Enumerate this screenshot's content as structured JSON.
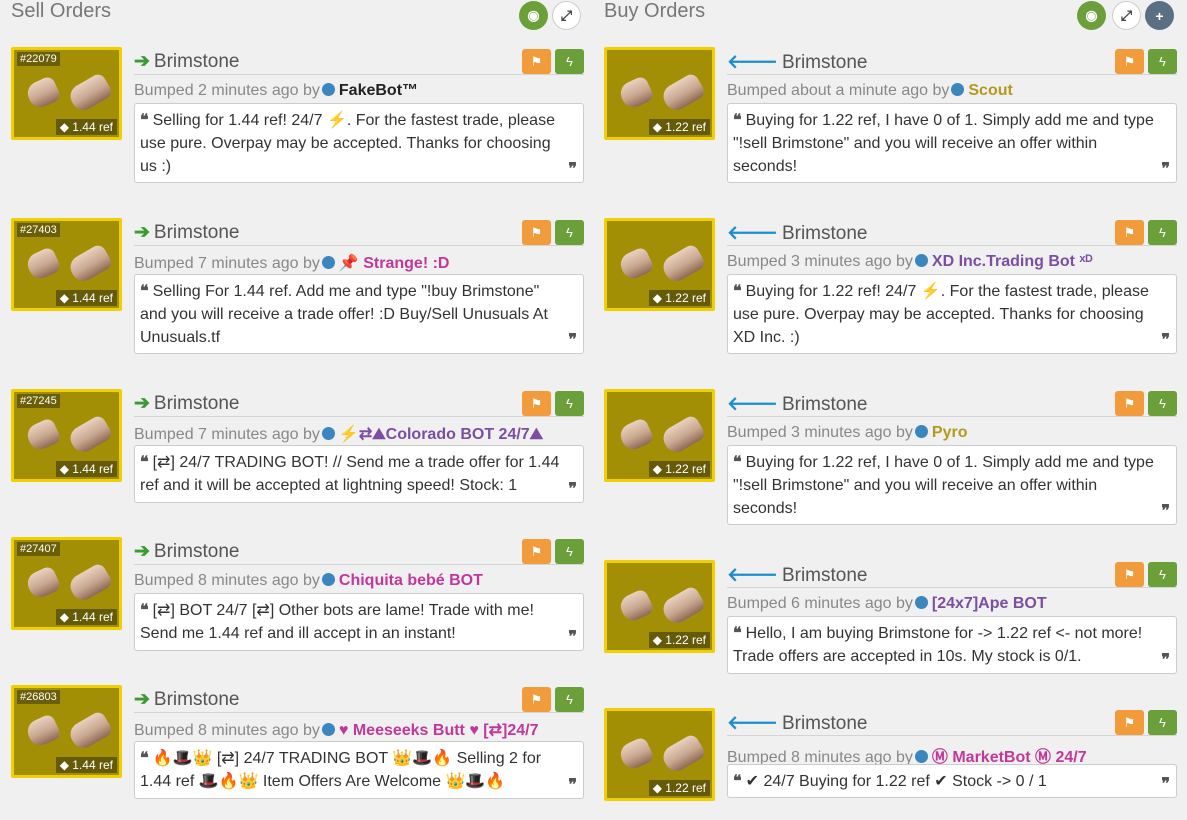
{
  "sell": {
    "title": "Sell Orders",
    "buttons": {
      "visibility": "◉",
      "expand": "⤢"
    },
    "listings": [
      {
        "id": "#22079",
        "price": "◆ 1.44 ref",
        "item": "Brimstone",
        "bumped": "Bumped 2 minutes ago by",
        "user": "FakeBot™",
        "user_color": "#222222",
        "message": "Selling for 1.44 ref! 24/7 ⚡. For the fastest trade, please use pure. Overpay may be accepted. Thanks for choosing us :)"
      },
      {
        "id": "#27403",
        "price": "◆ 1.44 ref",
        "item": "Brimstone",
        "bumped": "Bumped 7 minutes ago by",
        "user": "📌 Strange! :D",
        "user_color": "#c1389b",
        "message": "Selling For 1.44 ref. Add me and type \"!buy Brimstone\" and you will receive a trade offer! :D Buy/Sell Unusuals At Unusuals.tf"
      },
      {
        "id": "#27245",
        "price": "◆ 1.44 ref",
        "item": "Brimstone",
        "bumped": "Bumped 7 minutes ago by",
        "user": "⚡⇄⛰Colorado BOT 24/7⛰",
        "user_color": "#7b4ea3",
        "message": "[⇄] 24/7 TRADING BOT! // Send me a trade offer for 1.44 ref and it will be accepted at lightning speed! Stock: 1"
      },
      {
        "id": "#27407",
        "price": "◆ 1.44 ref",
        "item": "Brimstone",
        "bumped": "Bumped 8 minutes ago by",
        "user": "Chiquita bebé BOT",
        "user_color": "#c1389b",
        "message": "[⇄] BOT 24/7 [⇄] Other bots are lame! Trade with me! Send me 1.44 ref and ill accept in an instant!"
      },
      {
        "id": "#26803",
        "price": "◆ 1.44 ref",
        "item": "Brimstone",
        "bumped": "Bumped 8 minutes ago by",
        "user": "♥ Meeseeks Butt ♥ [⇄]24/7",
        "user_color": "#c1389b",
        "message": "🔥🎩👑 [⇄] 24/7 TRADING BOT 👑🎩🔥 Selling 2 for 1.44 ref 🎩🔥👑 Item Offers Are Welcome 👑🎩🔥"
      }
    ]
  },
  "buy": {
    "title": "Buy Orders",
    "buttons": {
      "visibility": "◉",
      "expand": "⤢",
      "add": "+"
    },
    "listings": [
      {
        "price": "◆ 1.22 ref",
        "item": "Brimstone",
        "bumped": "Bumped about a minute ago by",
        "user": "Scout",
        "user_color": "#b39a1f",
        "message": "Buying for 1.22 ref, I have 0 of 1. Simply add me and type \"!sell Brimstone\" and you will receive an offer within seconds!"
      },
      {
        "price": "◆ 1.22 ref",
        "item": "Brimstone",
        "bumped": "Bumped 3 minutes ago by",
        "user": "XD Inc.Trading Bot ˣᴰ",
        "user_color": "#7b4ea3",
        "message": "Buying for 1.22 ref! 24/7 ⚡. For the fastest trade, please use pure. Overpay may be accepted. Thanks for choosing XD Inc. :)"
      },
      {
        "price": "◆ 1.22 ref",
        "item": "Brimstone",
        "bumped": "Bumped 3 minutes ago by",
        "user": "Pyro",
        "user_color": "#b39a1f",
        "message": "Buying for 1.22 ref, I have 0 of 1. Simply add me and type \"!sell Brimstone\" and you will receive an offer within seconds!"
      },
      {
        "price": "◆ 1.22 ref",
        "item": "Brimstone",
        "bumped": "Bumped 6 minutes ago by",
        "user": "[24x7]Ape BOT",
        "user_color": "#7b4ea3",
        "message": "Hello, I am buying Brimstone for -> 1.22 ref <- not more! Trade offers are accepted in 10s. My stock is 0/1."
      },
      {
        "price": "◆ 1.22 ref",
        "item": "Brimstone",
        "bumped": "Bumped 8 minutes ago by",
        "user": "Ⓜ MarketBot Ⓜ 24/7",
        "user_color": "#c1389b",
        "message": "✔ 24/7 Buying for 1.22 ref ✔ Stock -> 0 / 1"
      }
    ]
  }
}
